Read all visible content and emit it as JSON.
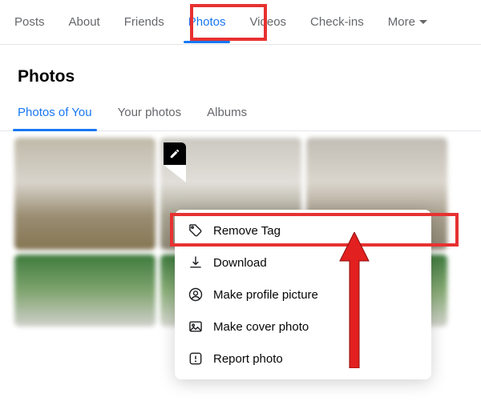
{
  "topnav": {
    "items": [
      {
        "label": "Posts"
      },
      {
        "label": "About"
      },
      {
        "label": "Friends"
      },
      {
        "label": "Photos"
      },
      {
        "label": "Videos"
      },
      {
        "label": "Check-ins"
      }
    ],
    "more_label": "More"
  },
  "section_title": "Photos",
  "subtabs": {
    "items": [
      {
        "label": "Photos of You"
      },
      {
        "label": "Your photos"
      },
      {
        "label": "Albums"
      }
    ]
  },
  "menu": {
    "items": [
      {
        "label": "Remove Tag"
      },
      {
        "label": "Download"
      },
      {
        "label": "Make profile picture"
      },
      {
        "label": "Make cover photo"
      },
      {
        "label": "Report photo"
      }
    ]
  }
}
